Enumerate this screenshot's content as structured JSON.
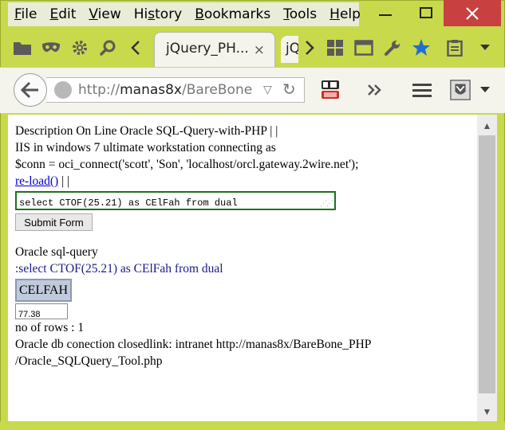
{
  "menu": {
    "items": [
      "File",
      "Edit",
      "View",
      "History",
      "Bookmarks",
      "Tools",
      "Help"
    ],
    "mnemonic": [
      "F",
      "E",
      "V",
      "s",
      "B",
      "T",
      "H"
    ]
  },
  "tab": {
    "active_title": "jQuery_PH...",
    "close_glyph": "×",
    "second_title": "jQ"
  },
  "address": {
    "prefix": "http://",
    "host": "manas8x",
    "path": "/BareBone_P"
  },
  "page": {
    "line1": "Description On Line Oracle SQL-Query-with-PHP | |",
    "line2": "IIS in windows 7 ultimate workstation connecting as",
    "line3": "$conn = oci_connect('scott', 'Son', 'localhost/orcl.gateway.2wire.net');",
    "reload_link": "re-load()",
    "reload_suffix": " | |",
    "query_value": "select CTOF(25.21) as CElFah from dual",
    "submit_label": "Submit Form",
    "section_title": "Oracle sql-query",
    "executed_query": ":select CTOF(25.21) as CElFah from dual",
    "result_column": "CELFAH",
    "result_value": "77.38",
    "row_count": "no of rows : 1",
    "closed_line": "Oracle db conection closedlink: intranet http://manas8x/BareBone_PHP",
    "closed_line2": "/Oracle_SQLQuery_Tool.php"
  },
  "colors": {
    "chrome": "#c9d94c",
    "close_button": "#c84040",
    "link": "#0000cc",
    "query_border": "#207020"
  }
}
